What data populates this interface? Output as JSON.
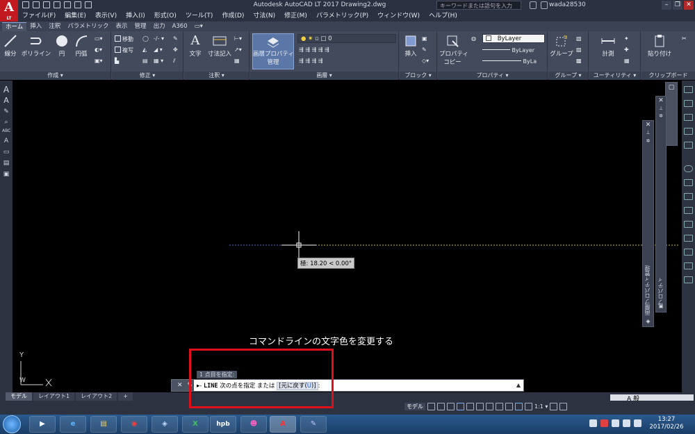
{
  "titlebar": {
    "title": "Autodesk AutoCAD LT 2017    Drawing2.dwg",
    "search_placeholder": "キーワードまたは語句を入力",
    "user": "wada28530",
    "logo": "A",
    "logo_sub": "LT",
    "min": "–",
    "restore": "❐",
    "close": "✕"
  },
  "menu": [
    "ファイル(F)",
    "編集(E)",
    "表示(V)",
    "挿入(I)",
    "形式(O)",
    "ツール(T)",
    "作成(D)",
    "寸法(N)",
    "修正(M)",
    "パラメトリック(P)",
    "ウィンドウ(W)",
    "ヘルプ(H)"
  ],
  "ribbon_tabs": [
    "ホーム",
    "挿入",
    "注釈",
    "パラメトリック",
    "表示",
    "管理",
    "出力",
    "A360",
    "▭▾"
  ],
  "active_tab": 0,
  "panels": {
    "create": {
      "title": "作成 ▾",
      "tools": [
        "線分",
        "ポリライン",
        "円",
        "円弧"
      ]
    },
    "modify": {
      "title": "修正 ▾",
      "tools": [
        "移動",
        "複写"
      ]
    },
    "annotation": {
      "title": "注釈 ▾",
      "tools": [
        "文字",
        "寸法記入"
      ]
    },
    "layers": {
      "title": "画層 ▾",
      "tools": [
        "画層プロパティ",
        "管理"
      ],
      "current_layer": "0"
    },
    "block": {
      "title": "ブロック ▾",
      "tools": [
        "挿入"
      ]
    },
    "properties": {
      "title": "プロパティ ▾",
      "tools": [
        "プロパティ",
        "コピー"
      ],
      "color": "ByLayer",
      "linetype": "ByLayer",
      "lineweight": "ByLa"
    },
    "groups": {
      "title": "グループ ▾",
      "tools": [
        "グループ"
      ]
    },
    "utilities": {
      "title": "ユーティリティ ▾",
      "tools": [
        "計測"
      ]
    },
    "clipboard": {
      "title": "クリップボード",
      "tools": [
        "貼り付け"
      ]
    }
  },
  "palettes": {
    "layer_props_label": "画層プロパティ管理",
    "properties_label": "プロパティ",
    "close": "✕"
  },
  "canvas": {
    "tooltip": "極: 18.20 < 0.00°",
    "ucs_y": "Y",
    "ucs_w": "W",
    "annotation_caption": "コマンドラインの文字色を変更する"
  },
  "command_line": {
    "history": "1 点目を指定:",
    "close": "✕",
    "prompt_prefix": "LINE",
    "prompt_text": " 次の点を指定 または ",
    "option_open": "[元に戻す(",
    "option_key": "U",
    "option_close": ")]",
    "prompt_end": ":",
    "arrow": "▲"
  },
  "layout_tabs": [
    "モデル",
    "レイアウト1",
    "レイアウト2",
    "+"
  ],
  "active_layout": 0,
  "statusbar": {
    "model": "モデル",
    "scale": "1:1 ▾",
    "ime": "A 般"
  },
  "taskbar": {
    "apps": [
      "",
      "▶",
      "e",
      "▤",
      "◉",
      "◈",
      "X",
      "hpb",
      "☻",
      "A",
      "✎"
    ],
    "time": "13:27",
    "date": "2017/02/26"
  },
  "colors": {
    "accent": "#c2181f",
    "ribbon_bg": "#434a5b",
    "annotation_box": "#e0101a",
    "command_option": "#1a52c8"
  }
}
